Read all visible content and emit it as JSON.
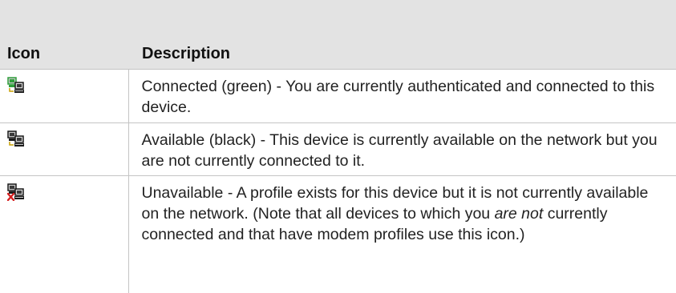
{
  "table": {
    "headers": {
      "icon": "Icon",
      "description": "Description"
    },
    "rows": [
      {
        "icon_name": "connected-device-icon",
        "icon_color": "#2e9e3a",
        "text": "Connected (green) - You are currently authenticated and connected to this device."
      },
      {
        "icon_name": "available-device-icon",
        "icon_color": "#1a1a1a",
        "text": "Available (black) - This device is currently available on the network but you are not currently connected to it."
      },
      {
        "icon_name": "unavailable-device-icon",
        "icon_color": "#d42020",
        "text_before": "Unavailable - A profile exists for this device but it is not currently available on the network. (Note that all devices to which you ",
        "text_emphasis": "are not",
        "text_after": " currently connected and that have modem profiles use this icon.)"
      }
    ]
  }
}
